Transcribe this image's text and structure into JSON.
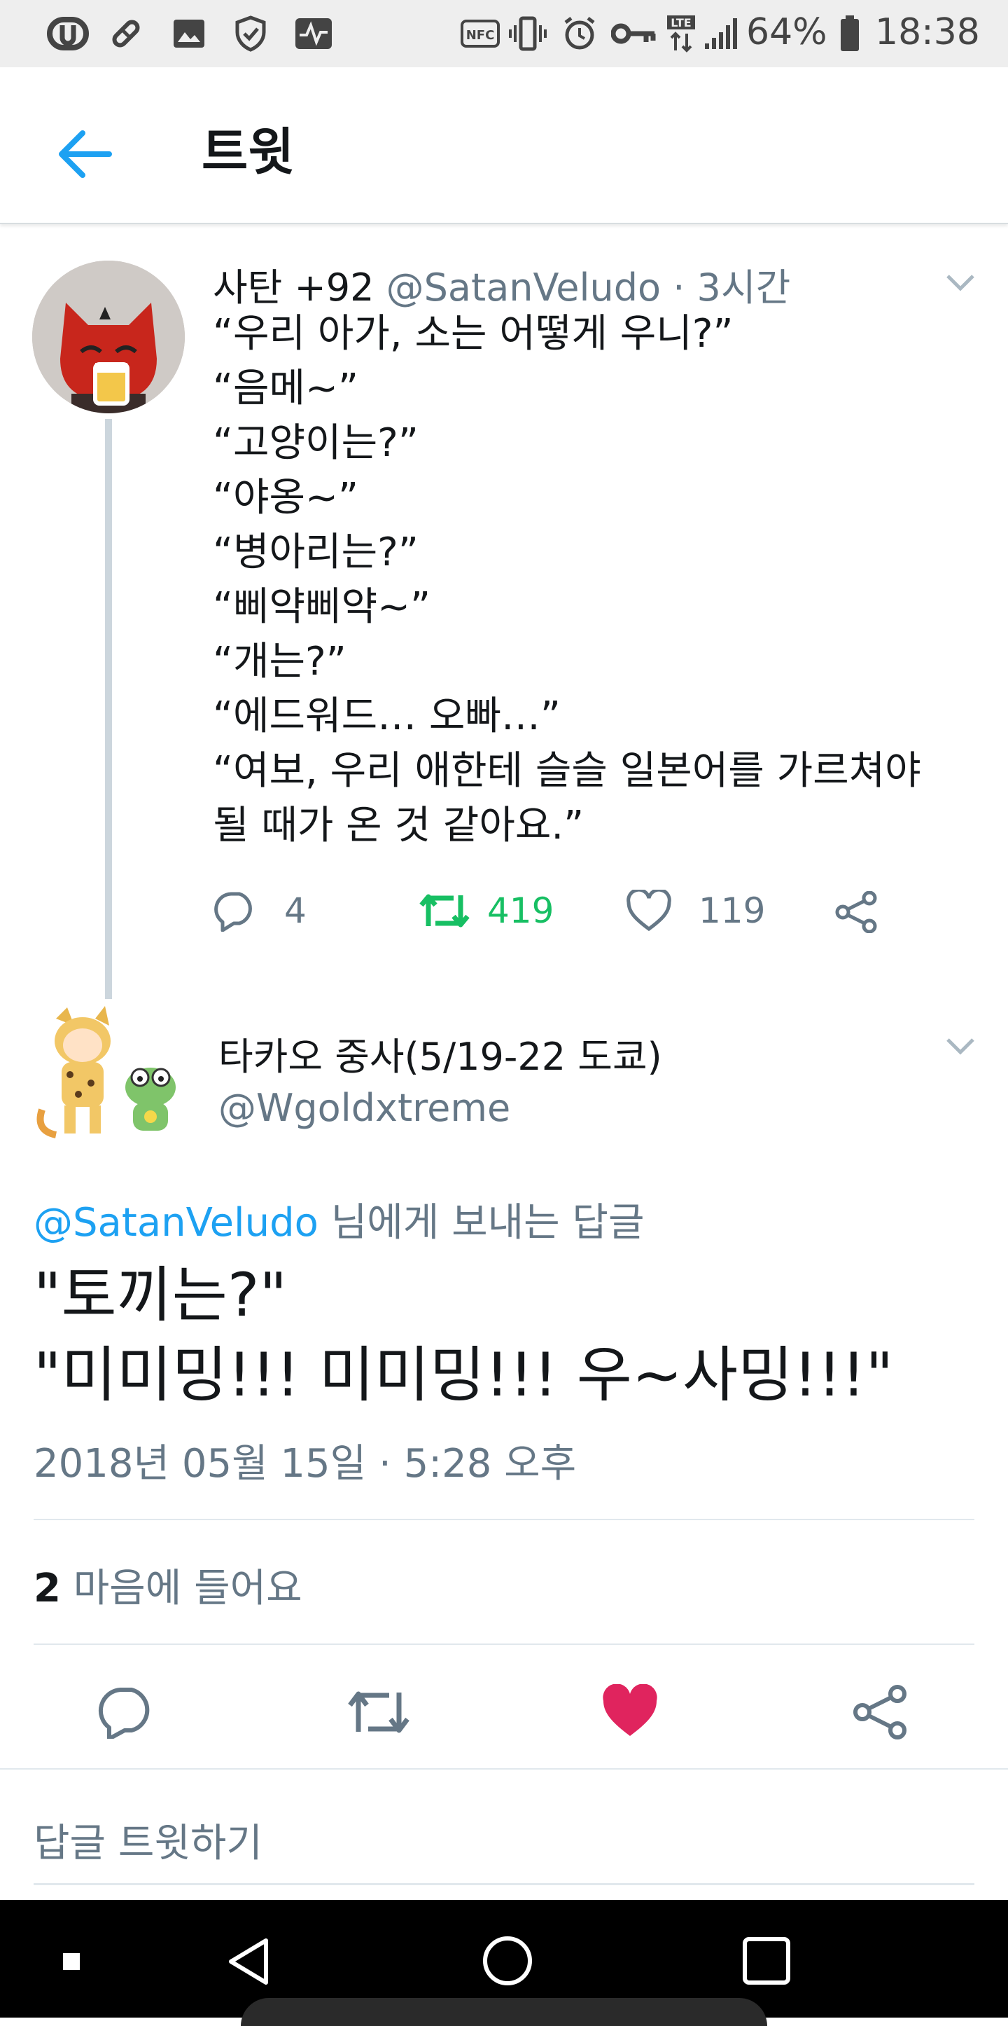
{
  "status_bar": {
    "battery": "64%",
    "time": "18:38",
    "lte": "LTE",
    "nfc": "NFC"
  },
  "header": {
    "back_icon": "arrow-left-icon",
    "title": "트윗"
  },
  "tweet1": {
    "name": "사탄 +92",
    "handle": "@SatanVeludo",
    "time": "· 3시간",
    "text": "“우리 아가, 소는 어떻게 우니?”\n“음메~”\n“고양이는?”\n“야옹~”\n“병아리는?”\n“삐약삐약~”\n“개는?”\n“에드워드… 오빠…”\n“여보, 우리 애한테 슬슬 일본어를 가르쳐야\n될 때가 온 것 같아요.”",
    "replies": "4",
    "retweets": "419",
    "likes": "119",
    "retweet_color": "#17bf63"
  },
  "tweet2": {
    "name": "타카오 중사(5/19-22 도쿄)",
    "handle": "@Wgoldxtreme",
    "reply_to_handle": "@SatanVeludo",
    "reply_to_suffix": " 님에게 보내는 답글",
    "text": "\"토끼는?\"\n\"미미밍!!! 미미밍!!! 우~사밍!!!\"",
    "timestamp": "2018년 05월 15일 · 5:28 오후",
    "likes_count": "2",
    "likes_label": " 마음에 들어요",
    "like_color": "#e0245e"
  },
  "reply_bar": {
    "placeholder": "답글 트윗하기"
  },
  "colors": {
    "accent": "#1da1f2",
    "secondary_text": "#657786"
  }
}
